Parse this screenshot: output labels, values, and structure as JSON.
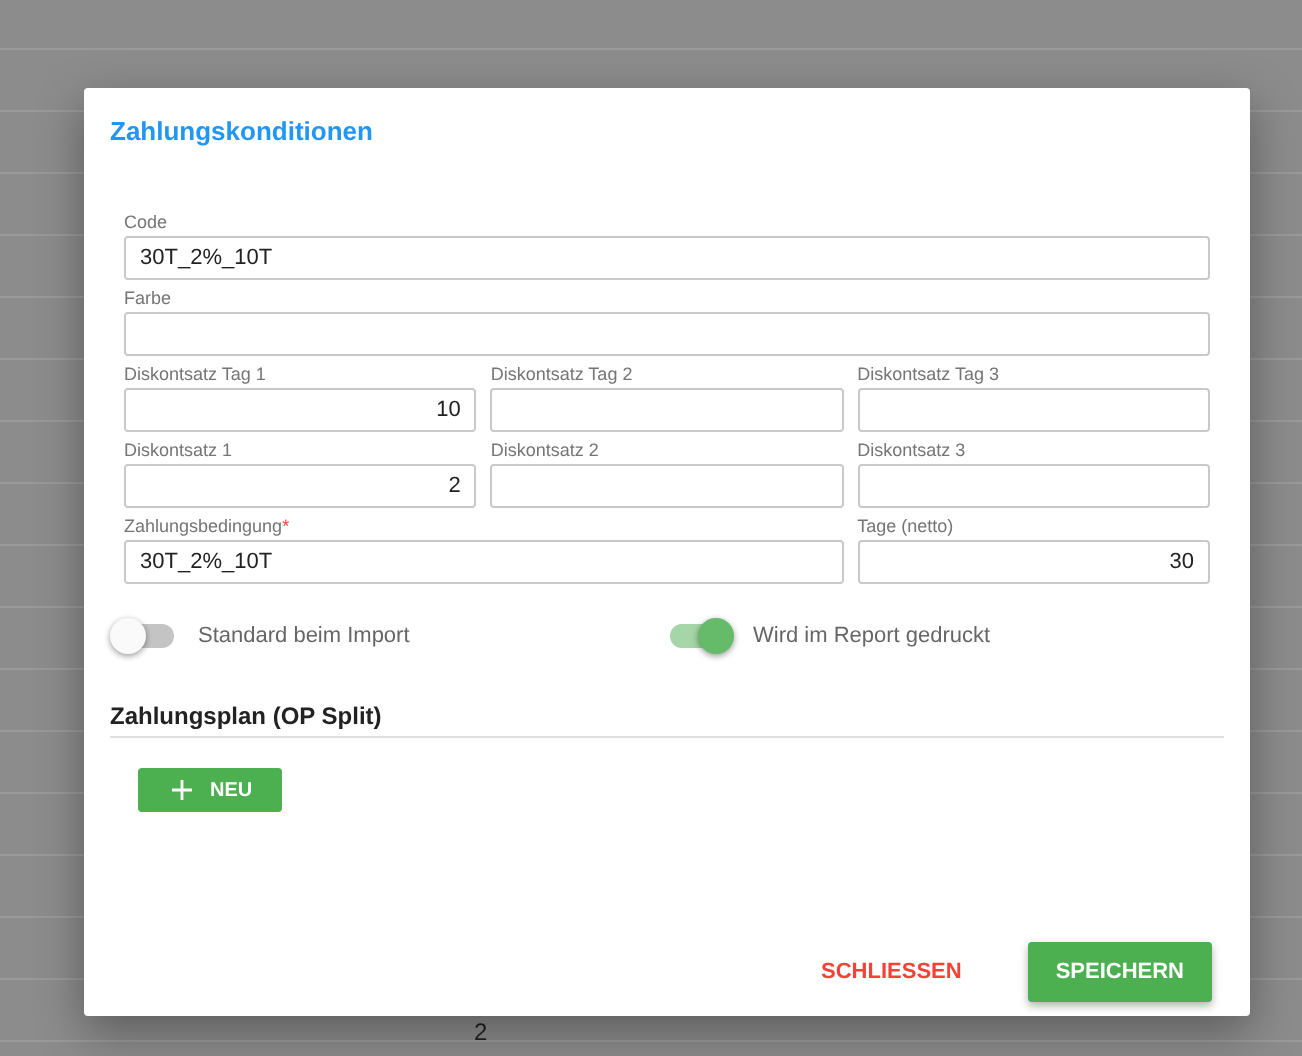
{
  "background": {
    "page_number": "2"
  },
  "dialog": {
    "title": "Zahlungskonditionen",
    "field_rows": [
      {
        "fields": [
          {
            "label": "Code",
            "value": "30T_2%_10T",
            "kind": "text"
          }
        ]
      },
      {
        "fields": [
          {
            "label": "Farbe",
            "kind": "text"
          }
        ]
      },
      {
        "fields": [
          {
            "label": "Diskontsatz Tag 1",
            "value": "10",
            "kind": "number"
          },
          {
            "label": "Diskontsatz Tag 2",
            "kind": "number"
          },
          {
            "label": "Diskontsatz Tag 3",
            "kind": "number"
          }
        ]
      },
      {
        "fields": [
          {
            "label": "Diskontsatz 1",
            "value": "2",
            "kind": "number"
          },
          {
            "label": "Diskontsatz 2",
            "kind": "number"
          },
          {
            "label": "Diskontsatz 3",
            "kind": "number"
          }
        ]
      },
      {
        "fields": [
          {
            "label": "Zahlungsbedingung",
            "required_mark": "*",
            "value": "30T_2%_10T",
            "kind": "text"
          },
          {
            "label": "Tage (netto)",
            "value": "30",
            "kind": "number"
          }
        ]
      }
    ],
    "toggles": [
      {
        "label": "Standard beim Import",
        "on": false
      },
      {
        "label": "Wird im Report gedruckt",
        "on": true
      }
    ],
    "section_title": "Zahlungsplan (OP Split)",
    "add_button": {
      "label": "NEU"
    },
    "footer_buttons": [
      {
        "label": "SCHLIESSEN",
        "kind": "flat"
      },
      {
        "label": "SPEICHERN",
        "kind": "raised"
      }
    ]
  }
}
